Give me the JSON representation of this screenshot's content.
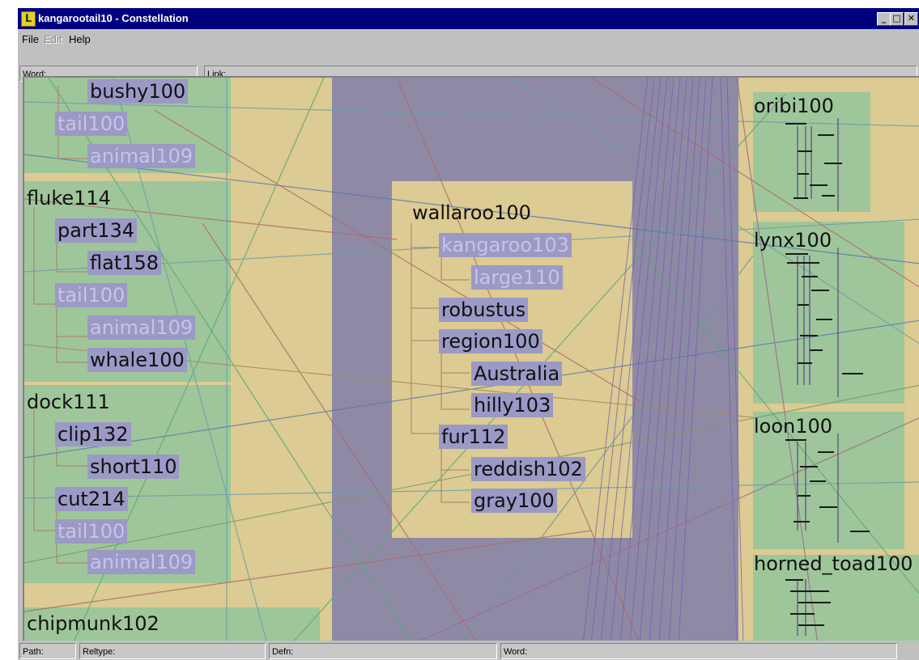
{
  "window": {
    "title": "kangarootail10 - Constellation",
    "app_icon_glyph": "L",
    "controls": {
      "minimize": "_",
      "maximize": "□",
      "close": "✕"
    }
  },
  "menu": {
    "file": "File",
    "edit": "Edit",
    "help": "Help"
  },
  "fields": {
    "word_label": "Word:",
    "link_label": "Link:"
  },
  "status": {
    "path": "Path:",
    "reltype": "Reltype:",
    "defn": "Defn:",
    "word": "Word:"
  },
  "graph": {
    "left_nodes": [
      "bushy100",
      "tail100",
      "animal109",
      "fluke114",
      "part134",
      "flat158",
      "tail100",
      "animal109",
      "whale100",
      "dock111",
      "clip132",
      "short110",
      "cut214",
      "tail100",
      "animal109",
      "chipmunk102"
    ],
    "center_nodes": [
      "wallaroo100",
      "kangaroo103",
      "large110",
      "robustus",
      "region100",
      "Australia",
      "hilly103",
      "fur112",
      "reddish102",
      "gray100"
    ],
    "right_nodes": [
      "oribi100",
      "lynx100",
      "loon100",
      "horned_toad100"
    ]
  },
  "colors": {
    "canvas_bg": "#dccb92",
    "green_panel": "#9ec69a",
    "purple_band": "#8e8aa6",
    "highlight": "#9b99c6",
    "dim_text": "#c7c4e4",
    "title_bar": "#00007f"
  }
}
